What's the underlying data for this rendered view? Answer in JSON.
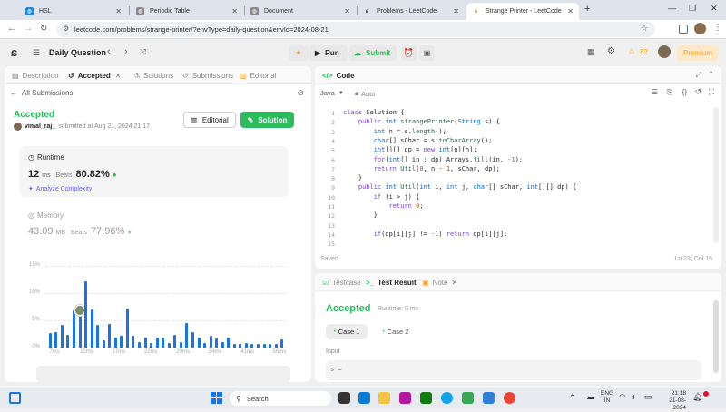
{
  "browser": {
    "tabs": [
      {
        "title": "HSL",
        "active": false
      },
      {
        "title": "Periodic Table",
        "active": false
      },
      {
        "title": "Document",
        "active": false
      },
      {
        "title": "Problems - LeetCode",
        "active": false
      },
      {
        "title": "Strange Printer - LeetCode",
        "active": true
      }
    ],
    "url": "leetcode.com/problems/strange-printer/?envType=daily-question&envId=2024-08-21"
  },
  "header": {
    "title": "Daily Question",
    "run_label": "Run",
    "submit_label": "Submit",
    "streak": "82",
    "premium_label": "Premium"
  },
  "left": {
    "tabs": [
      "Description",
      "Accepted",
      "Solutions",
      "Submissions",
      "Editorial"
    ],
    "back_label": "All Submissions",
    "status": "Accepted",
    "user": "vimal_raj_",
    "submitted": "submitted at Aug 21, 2024 21:17",
    "editorial_btn": "Editorial",
    "solution_btn": "Solution",
    "runtime_label": "Runtime",
    "runtime_value": "12",
    "runtime_unit": "ms",
    "beats_label": "Beats",
    "runtime_beats": "80.82%",
    "analyze_label": "Analyze Complexity",
    "memory_label": "Memory",
    "memory_value": "43.09",
    "memory_unit": "MB",
    "memory_beats_label": "Beats",
    "memory_beats": "77.96%"
  },
  "chart_data": {
    "type": "bar",
    "yticks": [
      "15%",
      "10%",
      "5%",
      "0%"
    ],
    "xticks": [
      "7ms",
      "12ms",
      "17ms",
      "22ms",
      "29ms",
      "34ms",
      "41ms",
      "56ms"
    ],
    "ylim": [
      0,
      15
    ],
    "values": [
      2.6,
      2.8,
      4.1,
      2.3,
      6.8,
      6.9,
      12.2,
      7.0,
      4.2,
      1.4,
      4.3,
      1.8,
      2.2,
      7.2,
      2.2,
      1.0,
      1.8,
      0.9,
      1.8,
      1.8,
      0.8,
      2.3,
      1.0,
      4.5,
      2.9,
      1.8,
      0.9,
      2.1,
      1.7,
      1.0,
      1.9,
      0.6,
      0.6,
      0.9,
      0.6,
      0.6,
      0.7,
      0.6,
      0.7,
      1.5
    ],
    "highlight_index": 5
  },
  "code": {
    "tab_label": "Code",
    "language": "Java",
    "mode": "Auto",
    "status": "Saved",
    "cursor": "Ln 23, Col 15",
    "lines": [
      "class Solution {",
      "    public int strangePrinter(String s) {",
      "        int n = s.length();",
      "        char[] sChar = s.toCharArray();",
      "        int[][] dp = new int[n][n];",
      "        for(int[] in : dp) Arrays.fill(in, -1);",
      "        return Util(0, n - 1, sChar, dp);",
      "    }",
      "    public int Util(int i, int j, char[] sChar, int[][] dp) {",
      "        if (i > j) {",
      "            return 0;",
      "        }",
      "",
      "        if(dp[i][j] != -1) return dp[i][j];",
      ""
    ]
  },
  "bottom": {
    "tabs": [
      "Testcase",
      "Test Result",
      "Note"
    ],
    "result": "Accepted",
    "runtime": "Runtime: 0 ms",
    "cases": [
      "Case 1",
      "Case 2"
    ],
    "input_label": "Input",
    "input_var": "s ="
  },
  "taskbar": {
    "search": "Search",
    "lang1": "ENG",
    "lang2": "IN",
    "time": "21:18",
    "date": "21-08-2024"
  },
  "colors": {
    "accent_green": "#2cbb5d",
    "bar_blue": "#1a73e8",
    "orange": "#ffa116"
  }
}
